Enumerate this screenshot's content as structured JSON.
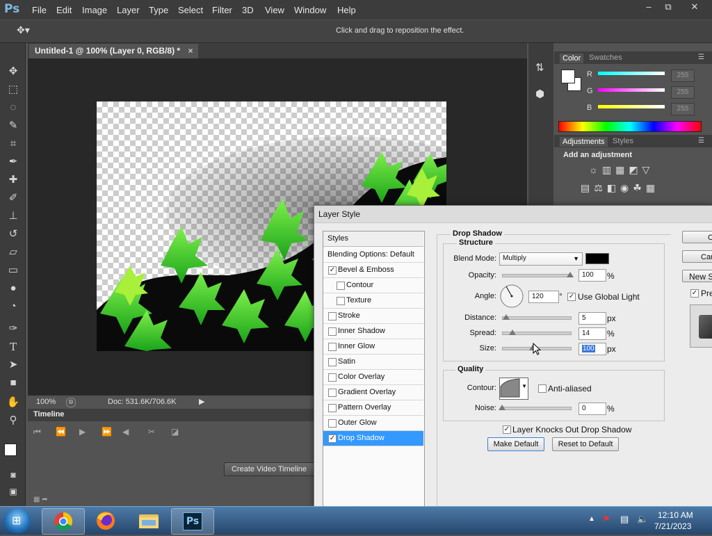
{
  "app": {
    "logo": "Ps"
  },
  "menu": [
    "File",
    "Edit",
    "Image",
    "Layer",
    "Type",
    "Select",
    "Filter",
    "3D",
    "View",
    "Window",
    "Help"
  ],
  "window_controls": {
    "minimize": "–",
    "restore": "⧉",
    "close": "✕"
  },
  "options_bar": {
    "hint": "Click and drag to reposition the effect."
  },
  "document": {
    "tab_title": "Untitled-1 @ 100% (Layer 0, RGB/8) *",
    "tab_close": "×",
    "zoom": "100%",
    "doc_info": "Doc: 531.6K/706.6K"
  },
  "timeline": {
    "title": "Timeline",
    "create_button": "Create Video Timeline"
  },
  "color_panel": {
    "tabs": [
      "Color",
      "Swatches"
    ],
    "channels": [
      {
        "label": "R",
        "value": "255",
        "color": "#00ffff"
      },
      {
        "label": "G",
        "value": "255",
        "color": "#ff00ff"
      },
      {
        "label": "B",
        "value": "255",
        "color": "#ffff00"
      }
    ]
  },
  "adjustments_panel": {
    "tabs": [
      "Adjustments",
      "Styles"
    ],
    "heading": "Add an adjustment"
  },
  "layer_style": {
    "title": "Layer Style",
    "styles_header": "Styles",
    "blending_options": "Blending Options: Default",
    "items": [
      {
        "label": "Bevel & Emboss",
        "checked": true,
        "indent": false
      },
      {
        "label": "Contour",
        "checked": false,
        "indent": true
      },
      {
        "label": "Texture",
        "checked": false,
        "indent": true
      },
      {
        "label": "Stroke",
        "checked": false,
        "indent": false
      },
      {
        "label": "Inner Shadow",
        "checked": false,
        "indent": false
      },
      {
        "label": "Inner Glow",
        "checked": false,
        "indent": false
      },
      {
        "label": "Satin",
        "checked": false,
        "indent": false
      },
      {
        "label": "Color Overlay",
        "checked": false,
        "indent": false
      },
      {
        "label": "Gradient Overlay",
        "checked": false,
        "indent": false
      },
      {
        "label": "Pattern Overlay",
        "checked": false,
        "indent": false
      },
      {
        "label": "Outer Glow",
        "checked": false,
        "indent": false
      },
      {
        "label": "Drop Shadow",
        "checked": true,
        "indent": false,
        "selected": true
      }
    ],
    "drop_shadow": {
      "section_title": "Drop Shadow",
      "structure_title": "Structure",
      "blend_mode_label": "Blend Mode:",
      "blend_mode": "Multiply",
      "shadow_color": "#000000",
      "opacity_label": "Opacity:",
      "opacity": "100",
      "angle_label": "Angle:",
      "angle": "120",
      "degree_symbol": "°",
      "use_global_light": "Use Global Light",
      "distance_label": "Distance:",
      "distance": "5",
      "spread_label": "Spread:",
      "spread": "14",
      "size_label": "Size:",
      "size": "100",
      "unit_percent": "%",
      "unit_px": "px",
      "quality_title": "Quality",
      "contour_label": "Contour:",
      "anti_aliased": "Anti-aliased",
      "noise_label": "Noise:",
      "noise": "0",
      "knocks_out": "Layer Knocks Out Drop Shadow",
      "make_default": "Make Default",
      "reset_default": "Reset to Default"
    },
    "side_buttons": [
      "O",
      "Can",
      "New S"
    ],
    "preview_label": "Pre"
  },
  "taskbar": {
    "time": "12:10 AM",
    "date": "7/21/2023",
    "ps_label": "Ps"
  }
}
